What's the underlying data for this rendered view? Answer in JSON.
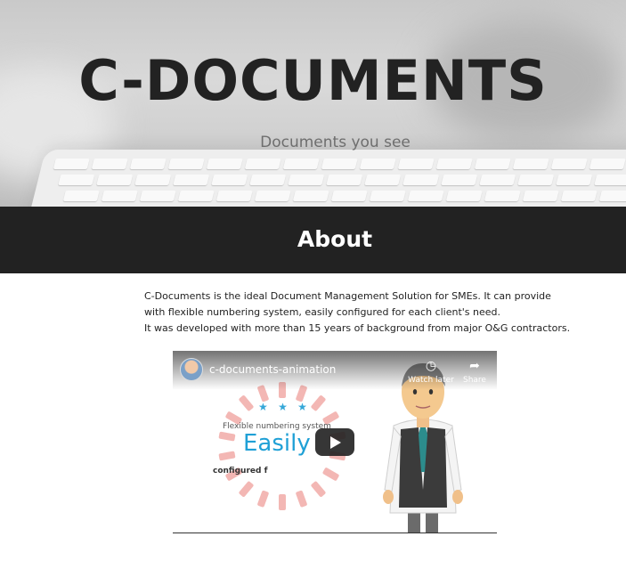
{
  "hero": {
    "title": "C-DOCUMENTS",
    "subtitle": "Documents you see"
  },
  "about": {
    "heading": "About",
    "paragraph_lines": [
      "C-Documents is the ideal Document Management Solution for SMEs. It can provide",
      "with flexible numbering system, easily configured for each client's need.",
      "It was developed with more than 15 years of background from major O&G contractors."
    ]
  },
  "video": {
    "title": "c-documents-animation",
    "watch_later_label": "Watch later",
    "share_label": "Share",
    "frame_text_line1": "Flexible numbering system",
    "frame_text_big": "Easily",
    "frame_text_line2": "configured f",
    "stars": "★ ★ ★"
  },
  "colors": {
    "hero_title": "#222222",
    "about_bar": "#222222",
    "accent_blue": "#1fa0d6"
  },
  "icons": [
    "clock-icon",
    "share-icon",
    "play-icon",
    "channel-avatar"
  ]
}
